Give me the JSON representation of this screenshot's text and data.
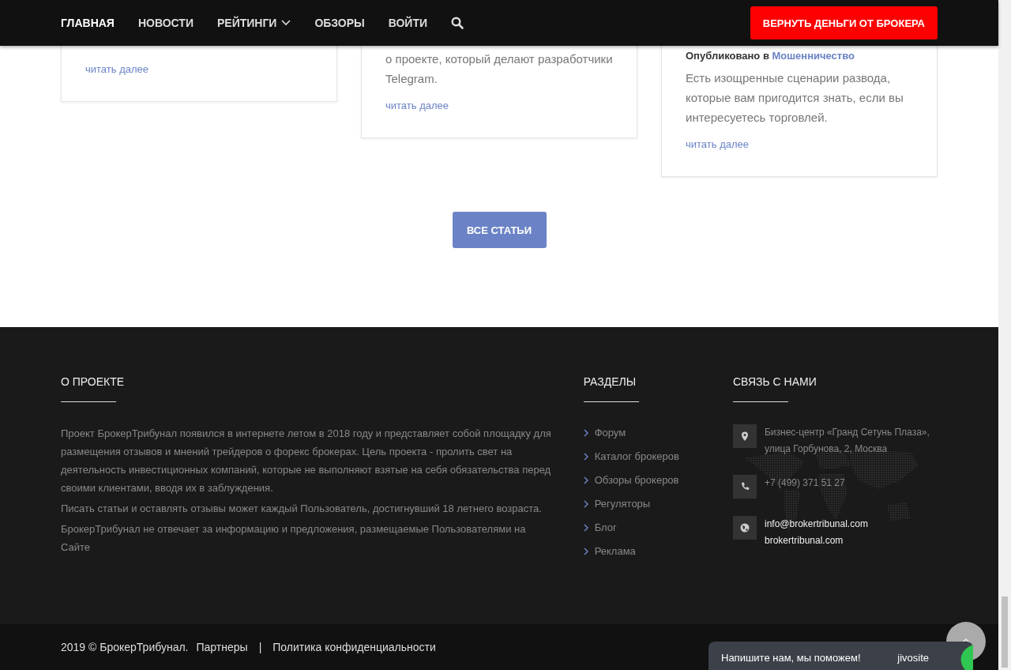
{
  "nav": {
    "items": [
      {
        "label": "ГЛАВНАЯ",
        "selected": true,
        "has_menu": false
      },
      {
        "label": "НОВОСТИ",
        "selected": false,
        "has_menu": false
      },
      {
        "label": "РЕЙТИНГИ",
        "selected": false,
        "has_menu": true
      },
      {
        "label": "ОБЗОРЫ",
        "selected": false,
        "has_menu": false
      },
      {
        "label": "ВОЙТИ",
        "selected": false,
        "has_menu": false
      }
    ],
    "cta": "ВЕРНУТЬ ДЕНЬГИ ОТ БРОКЕРА"
  },
  "cards": [
    {
      "link": "читать далее"
    },
    {
      "lines": [
        "о проекте, который делают разработчики Telegram."
      ],
      "link": "читать далее"
    },
    {
      "meta": "Опубликовано в",
      "category": "Мошенничество",
      "lines": [
        "Есть изощренные сценарии развода, которые вам пригодится знать, если вы интересуетесь торговлей."
      ],
      "link": "читать далее"
    }
  ],
  "all_button": "ВСЕ СТАТЬИ",
  "footer": {
    "about": {
      "heading": "О ПРОЕКТЕ",
      "paragraphs": [
        "Проект БрокерТрибунал появился в интернете летом в 2018 году и представляет собой площадку для размещения отзывов и мнений трейдеров о форекс брокерах. Цель проекта - пролить свет на деятельность инвестиционных компаний, которые не выполняют взятые на себя обязательства перед своими клиентами, вводя их в заблуждения.",
        "Писать статьи и оставлять отзывы может каждый Пользователь, достигнувший 18 летнего возраста.",
        "БрокерТрибунал не отвечает за информацию и предложения, размещаемые Пользователями на Сайте"
      ]
    },
    "sections": {
      "heading": "РАЗДЕЛЫ",
      "items": [
        "Форум",
        "Каталог брокеров",
        "Обзоры брокеров",
        "Регуляторы",
        "Блог",
        "Реклама"
      ]
    },
    "contacts": {
      "heading": "СВЯЗЬ С НАМИ",
      "items": [
        {
          "kind": "address",
          "lines": [
            "Бизнес-центр «Гранд Сетунь Плаза»,",
            "улица Горбунова, 2, Москва"
          ]
        },
        {
          "kind": "phone",
          "lines": [
            "+7 (499) 371 51 27"
          ]
        },
        {
          "kind": "web",
          "lines": [
            "info@brokertribunal.com",
            "brokertribunal.com"
          ]
        }
      ]
    }
  },
  "bottom": {
    "copyright": "2019 © БрокерТрибунал.",
    "links": [
      "Партнеры",
      "Политика конфиденциальности"
    ],
    "separator": "|"
  },
  "chat": {
    "text": "Напишите нам, мы поможем!",
    "brand": "jivosite"
  }
}
